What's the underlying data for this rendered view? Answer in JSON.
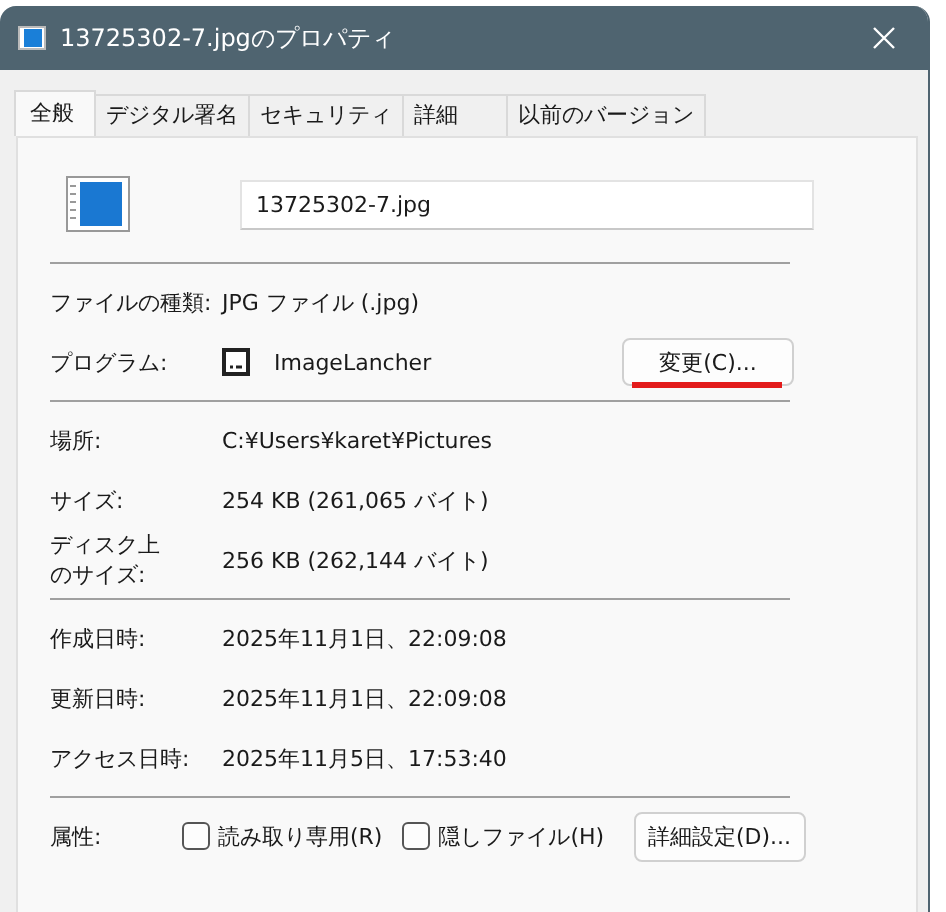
{
  "window": {
    "title": "13725302-7.jpgのプロパティ"
  },
  "tabs": [
    {
      "label": "全般",
      "selected": true
    },
    {
      "label": "デジタル署名",
      "selected": false
    },
    {
      "label": "セキュリティ",
      "selected": false
    },
    {
      "label": "詳細",
      "selected": false
    },
    {
      "label": "以前のバージョン",
      "selected": false
    }
  ],
  "file_name": "13725302-7.jpg",
  "sections": [
    {
      "rows": [
        {
          "kind": "text",
          "label": "ファイルの種類:",
          "value": "JPG ファイル (.jpg)"
        },
        {
          "kind": "program",
          "label": "プログラム:",
          "value": "ImageLancher",
          "button": "変更(C)...",
          "underlined": true
        }
      ]
    },
    {
      "rows": [
        {
          "kind": "text",
          "label": "場所:",
          "value": "C:¥Users¥karet¥Pictures"
        },
        {
          "kind": "text",
          "label": "サイズ:",
          "value": "254 KB (261,065 バイト)"
        },
        {
          "kind": "text",
          "label_lines": [
            "ディスク上",
            "のサイズ:"
          ],
          "value": "256 KB (262,144 バイト)"
        }
      ]
    },
    {
      "rows": [
        {
          "kind": "text",
          "label": "作成日時:",
          "value": "2025年11月1日、22:09:08"
        },
        {
          "kind": "text",
          "label": "更新日時:",
          "value": "2025年11月1日、22:09:08"
        },
        {
          "kind": "text",
          "label": "アクセス日時:",
          "value": "2025年11月5日、17:53:40"
        }
      ]
    },
    {
      "rows": [
        {
          "kind": "attributes",
          "label": "属性:",
          "checkboxes": [
            {
              "label": "読み取り専用(R)",
              "checked": false
            },
            {
              "label": "隠しファイル(H)",
              "checked": false
            }
          ],
          "button": "詳細設定(D)..."
        }
      ]
    }
  ]
}
